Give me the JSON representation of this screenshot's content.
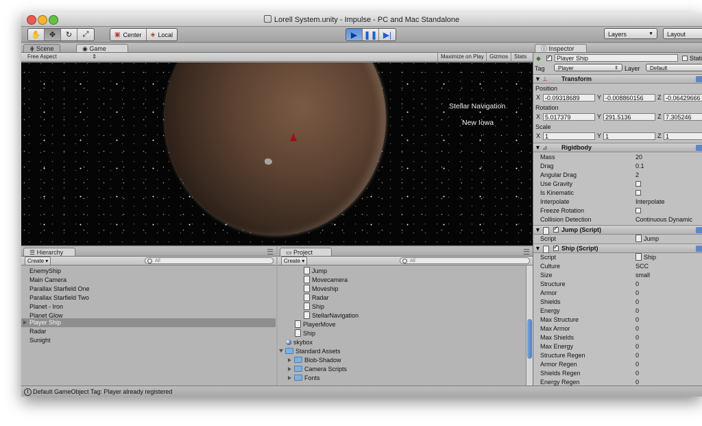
{
  "window": {
    "title": "Lorell System.unity - Impulse - PC and Mac Standalone"
  },
  "toolbar": {
    "tools": [
      "hand-icon",
      "move-icon",
      "rotate-icon",
      "scale-icon"
    ],
    "pivot_center": "Center",
    "pivot_local": "Local",
    "layers": "Layers",
    "layout": "Layout"
  },
  "scene_tab": "Scene",
  "game_tab": "Game",
  "game_toolbar": {
    "aspect": "Free Aspect",
    "maximize": "Maximize on Play",
    "gizmos": "Gizmos",
    "stats": "Stats"
  },
  "game_view": {
    "label_nav": "Stellar Navigation",
    "label_planet": "New Iowa"
  },
  "hierarchy": {
    "tab": "Hierarchy",
    "create": "Create",
    "search_placeholder": "All",
    "items": [
      "EnemyShip",
      "Main Camera",
      "Parallax Starfield One",
      "Parallax Starfield Two",
      "Planet - Iron",
      "Planet Glow",
      "Player Ship",
      "Radar",
      "Sunight"
    ],
    "selected": "Player Ship"
  },
  "project": {
    "tab": "Project",
    "create": "Create",
    "search_placeholder": "All",
    "items": [
      {
        "label": "Jump",
        "type": "file"
      },
      {
        "label": "Movecamera",
        "type": "file"
      },
      {
        "label": "Moveship",
        "type": "file"
      },
      {
        "label": "Radar",
        "type": "file"
      },
      {
        "label": "Ship",
        "type": "file"
      },
      {
        "label": "StellarNavigation",
        "type": "file"
      },
      {
        "label": "PlayerMove",
        "type": "file"
      },
      {
        "label": "Ship",
        "type": "file"
      },
      {
        "label": "skybox",
        "type": "material"
      },
      {
        "label": "Standard Assets",
        "type": "folder-open"
      },
      {
        "label": "Blob-Shadow",
        "type": "folder"
      },
      {
        "label": "Camera Scripts",
        "type": "folder"
      },
      {
        "label": "Fonts",
        "type": "folder"
      }
    ]
  },
  "inspector": {
    "tab": "Inspector",
    "object_name": "Player Ship",
    "static_label": "Static",
    "tag_label": "Tag",
    "tag_value": "Player",
    "layer_label": "Layer",
    "layer_value": "Default",
    "transform": {
      "title": "Transform",
      "position_label": "Position",
      "position": {
        "x": "-0.09318689",
        "y": "-0.008860156",
        "z": "-0.06429666"
      },
      "rotation_label": "Rotation",
      "rotation": {
        "x": "5.017379",
        "y": "291.5136",
        "z": "7.305246"
      },
      "scale_label": "Scale",
      "scale": {
        "x": "1",
        "y": "1",
        "z": "1"
      }
    },
    "rigidbody": {
      "title": "Rigidbody",
      "mass_label": "Mass",
      "mass": "20",
      "drag_label": "Drag",
      "drag": "0.1",
      "angular_drag_label": "Angular Drag",
      "angular_drag": "2",
      "use_gravity_label": "Use Gravity",
      "is_kinematic_label": "Is Kinematic",
      "interpolate_label": "Interpolate",
      "interpolate": "Interpolate",
      "freeze_rotation_label": "Freeze Rotation",
      "collision_detection_label": "Collision Detection",
      "collision_detection": "Continuous Dynamic"
    },
    "jump_script": {
      "title": "Jump (Script)",
      "script_label": "Script",
      "script_value": "Jump"
    },
    "ship_script": {
      "title": "Ship (Script)",
      "rows": [
        {
          "label": "Script",
          "value": "Ship"
        },
        {
          "label": "Culture",
          "value": "SCC"
        },
        {
          "label": "Size",
          "value": "small"
        },
        {
          "label": "Structure",
          "value": "0"
        },
        {
          "label": "Armor",
          "value": "0"
        },
        {
          "label": "Shields",
          "value": "0"
        },
        {
          "label": "Energy",
          "value": "0"
        },
        {
          "label": "Max Structure",
          "value": "0"
        },
        {
          "label": "Max Armor",
          "value": "0"
        },
        {
          "label": "Max Shields",
          "value": "0"
        },
        {
          "label": "Max Energy",
          "value": "0"
        },
        {
          "label": "Structure Regen",
          "value": "0"
        },
        {
          "label": "Armor Regen",
          "value": "0"
        },
        {
          "label": "Shields Regen",
          "value": "0"
        },
        {
          "label": "Energy Regen",
          "value": "0"
        }
      ]
    }
  },
  "status": {
    "message": "Default GameObject Tag: Player already registered"
  }
}
